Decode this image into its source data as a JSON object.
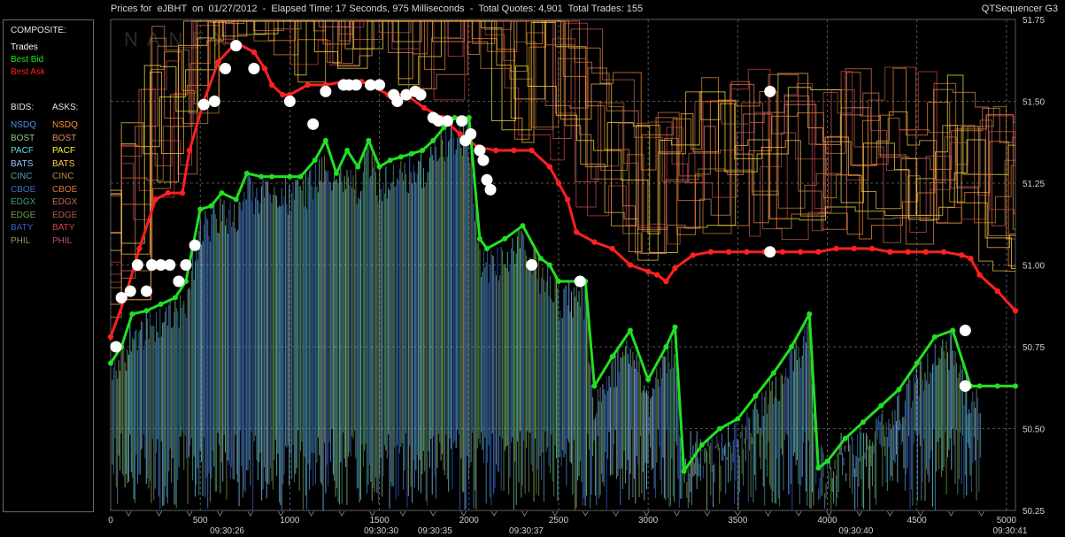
{
  "header": {
    "title": "Prices for  eJBHT  on  01/27/2012  -  Elapsed Time: 17 Seconds, 975 Milliseconds  -  Total Quotes: 4,901  Total Trades: 155",
    "app_name": "QTSequencer G3",
    "watermark": "NANEX"
  },
  "legend": {
    "composite_header": "COMPOSITE:",
    "composite": [
      {
        "label": "Trades",
        "color": "#ffffff"
      },
      {
        "label": "Best Bid",
        "color": "#22e022"
      },
      {
        "label": "Best Ask",
        "color": "#ff2020"
      }
    ],
    "bids_header": "BIDS:",
    "asks_header": "ASKS:",
    "bids": [
      {
        "label": "NSDQ",
        "color": "#4f8fe6"
      },
      {
        "label": "BOST",
        "color": "#8fc878"
      },
      {
        "label": "PACF",
        "color": "#60d8d8"
      },
      {
        "label": "BATS",
        "color": "#8fc8ff"
      },
      {
        "label": "CINC",
        "color": "#5aa0b8"
      },
      {
        "label": "CBOE",
        "color": "#3b6fc0"
      },
      {
        "label": "EDGX",
        "color": "#3e9e8e"
      },
      {
        "label": "EDGE",
        "color": "#6a9e4a"
      },
      {
        "label": "BATY",
        "color": "#3a5fcc"
      },
      {
        "label": "PHIL",
        "color": "#8c9a5a"
      }
    ],
    "asks": [
      {
        "label": "NSDQ",
        "color": "#ff9030"
      },
      {
        "label": "BOST",
        "color": "#e88860"
      },
      {
        "label": "PACF",
        "color": "#ffee40"
      },
      {
        "label": "BATS",
        "color": "#ffc850"
      },
      {
        "label": "CINC",
        "color": "#c08a3a"
      },
      {
        "label": "CBOE",
        "color": "#d87a3a"
      },
      {
        "label": "EDGX",
        "color": "#c86a50"
      },
      {
        "label": "EDGE",
        "color": "#b85a40"
      },
      {
        "label": "BATY",
        "color": "#d84040"
      },
      {
        "label": "PHIL",
        "color": "#c05068"
      }
    ]
  },
  "chart_data": {
    "type": "line",
    "xlim": [
      0,
      5050
    ],
    "ylim": [
      50.25,
      51.75
    ],
    "x_ticks": [
      "0",
      "500",
      "1000",
      "1500",
      "2000",
      "2500",
      "3000",
      "3500",
      "4000",
      "4500",
      "5000"
    ],
    "y_ticks": [
      "50.25",
      "50.50",
      "50.75",
      "51.00",
      "51.25",
      "51.50",
      "51.75"
    ],
    "time_labels": [
      {
        "x": 650,
        "label": "09:30:26"
      },
      {
        "x": 1510,
        "label": "09:30:30"
      },
      {
        "x": 1810,
        "label": "09:30:35"
      },
      {
        "x": 2320,
        "label": "09:30:37"
      },
      {
        "x": 4160,
        "label": "09:30:40"
      },
      {
        "x": 5020,
        "label": "09:30:41"
      }
    ],
    "grid": true,
    "series": [
      {
        "name": "Best Ask",
        "color": "#ff2020",
        "x": [
          0,
          80,
          160,
          250,
          320,
          400,
          440,
          520,
          600,
          700,
          800,
          860,
          900,
          960,
          1000,
          1100,
          1200,
          1300,
          1400,
          1450,
          1550,
          1650,
          1750,
          1850,
          1950,
          2050,
          2150,
          2250,
          2350,
          2450,
          2500,
          2550,
          2600,
          2700,
          2800,
          2900,
          3000,
          3050,
          3100,
          3150,
          3250,
          3350,
          3450,
          3550,
          3650,
          3750,
          3850,
          3950,
          4050,
          4150,
          4250,
          4350,
          4450,
          4550,
          4650,
          4750,
          4800,
          4850,
          4950,
          5050
        ],
        "y": [
          50.78,
          50.9,
          51.05,
          51.2,
          51.22,
          51.22,
          51.35,
          51.5,
          51.62,
          51.68,
          51.65,
          51.6,
          51.55,
          51.52,
          51.52,
          51.55,
          51.55,
          51.56,
          51.56,
          51.55,
          51.52,
          51.52,
          51.48,
          51.45,
          51.4,
          51.36,
          51.35,
          51.35,
          51.35,
          51.3,
          51.25,
          51.2,
          51.1,
          51.07,
          51.05,
          51.0,
          50.98,
          50.97,
          50.95,
          50.99,
          51.03,
          51.04,
          51.04,
          51.04,
          51.04,
          51.04,
          51.04,
          51.04,
          51.05,
          51.05,
          51.05,
          51.04,
          51.04,
          51.04,
          51.04,
          51.03,
          51.02,
          50.97,
          50.92,
          50.86
        ]
      },
      {
        "name": "Best Bid",
        "color": "#22e022",
        "x": [
          0,
          60,
          120,
          200,
          280,
          360,
          420,
          500,
          560,
          620,
          700,
          760,
          840,
          900,
          1000,
          1060,
          1140,
          1200,
          1260,
          1320,
          1380,
          1440,
          1500,
          1560,
          1620,
          1680,
          1740,
          1800,
          1860,
          1920,
          2000,
          2060,
          2100,
          2200,
          2300,
          2400,
          2450,
          2500,
          2600,
          2650,
          2700,
          2800,
          2900,
          3000,
          3100,
          3150,
          3200,
          3300,
          3400,
          3500,
          3600,
          3700,
          3800,
          3900,
          3950,
          4000,
          4100,
          4200,
          4300,
          4400,
          4500,
          4600,
          4700,
          4800,
          4850,
          4950,
          5050
        ],
        "y": [
          50.7,
          50.75,
          50.85,
          50.86,
          50.88,
          50.9,
          50.95,
          51.17,
          51.18,
          51.22,
          51.2,
          51.28,
          51.27,
          51.27,
          51.27,
          51.27,
          51.32,
          51.38,
          51.28,
          51.35,
          51.3,
          51.38,
          51.3,
          51.32,
          51.33,
          51.34,
          51.35,
          51.38,
          51.42,
          51.45,
          51.45,
          51.08,
          51.05,
          51.08,
          51.12,
          51.02,
          51.0,
          50.95,
          50.95,
          50.95,
          50.63,
          50.72,
          50.8,
          50.65,
          50.75,
          50.81,
          50.37,
          50.45,
          50.5,
          50.53,
          50.6,
          50.67,
          50.75,
          50.85,
          50.38,
          50.4,
          50.47,
          50.52,
          50.57,
          50.62,
          50.7,
          50.78,
          50.8,
          50.63,
          50.63,
          50.63,
          50.63
        ]
      },
      {
        "name": "Trades",
        "color": "#ffffff",
        "x": [
          30,
          60,
          110,
          150,
          200,
          230,
          280,
          330,
          380,
          420,
          470,
          520,
          580,
          640,
          700,
          800,
          1000,
          1130,
          1200,
          1300,
          1330,
          1370,
          1450,
          1500,
          1580,
          1600,
          1650,
          1700,
          1730,
          1800,
          1830,
          1880,
          1960,
          1980,
          2010,
          2060,
          2080,
          2100,
          2120,
          2350,
          2620,
          3680,
          3680,
          4770,
          4770
        ],
        "y": [
          50.75,
          50.9,
          50.92,
          51.0,
          50.92,
          51.0,
          51.0,
          51.0,
          50.95,
          51.0,
          51.06,
          51.49,
          51.5,
          51.6,
          51.67,
          51.6,
          51.5,
          51.43,
          51.53,
          51.55,
          51.55,
          51.55,
          51.55,
          51.55,
          51.52,
          51.5,
          51.52,
          51.53,
          51.52,
          51.45,
          51.44,
          51.44,
          51.44,
          51.38,
          51.4,
          51.35,
          51.32,
          51.26,
          51.23,
          51.0,
          50.95,
          51.53,
          51.04,
          50.8,
          50.63
        ]
      }
    ]
  }
}
